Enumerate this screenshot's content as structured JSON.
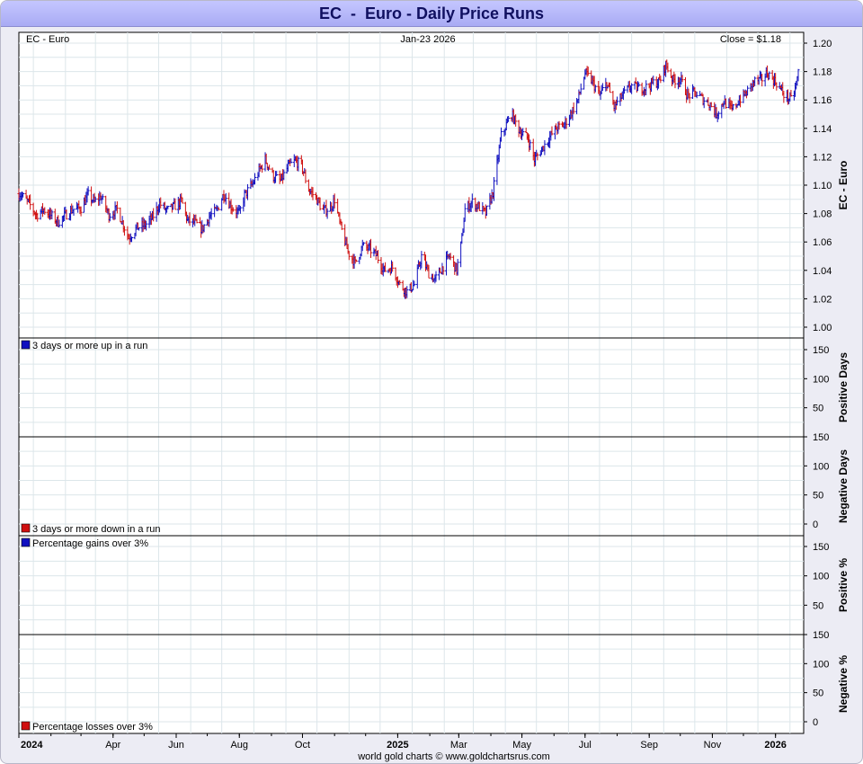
{
  "page": {
    "title": "EC  -  Euro - Daily Price Runs",
    "footer": "world gold charts © www.goldchartsrus.com"
  },
  "colors": {
    "up": "#1010c0",
    "down": "#d01010",
    "grid": "#dce6ea",
    "frame": "#ececf4",
    "title_bar": "#b4b6fa"
  },
  "chart_data": [
    {
      "type": "ohlc",
      "header_left": "EC  -  Euro",
      "header_center": "Jan-23  2026",
      "header_right": "Close = $1.18",
      "ylabel": "EC  -  Euro",
      "ylim": [
        1.0,
        1.2
      ],
      "yticks": [
        "1.20",
        "1.18",
        "1.16",
        "1.14",
        "1.12",
        "1.10",
        "1.08",
        "1.06",
        "1.04",
        "1.02",
        "1.00"
      ],
      "grid": true,
      "x_start": "2024-01-01",
      "x_end": "2026-01-23",
      "close_series": [
        [
          "2024-01-02",
          1.094
        ],
        [
          "2024-01-10",
          1.088
        ],
        [
          "2024-01-18",
          1.079
        ],
        [
          "2024-01-25",
          1.083
        ],
        [
          "2024-02-02",
          1.078
        ],
        [
          "2024-02-08",
          1.074
        ],
        [
          "2024-02-15",
          1.079
        ],
        [
          "2024-02-22",
          1.083
        ],
        [
          "2024-03-01",
          1.084
        ],
        [
          "2024-03-08",
          1.093
        ],
        [
          "2024-03-14",
          1.088
        ],
        [
          "2024-03-20",
          1.092
        ],
        [
          "2024-03-28",
          1.079
        ],
        [
          "2024-04-05",
          1.083
        ],
        [
          "2024-04-11",
          1.072
        ],
        [
          "2024-04-16",
          1.063
        ],
        [
          "2024-04-24",
          1.07
        ],
        [
          "2024-05-02",
          1.072
        ],
        [
          "2024-05-09",
          1.077
        ],
        [
          "2024-05-16",
          1.087
        ],
        [
          "2024-05-23",
          1.082
        ],
        [
          "2024-05-30",
          1.085
        ],
        [
          "2024-06-06",
          1.089
        ],
        [
          "2024-06-12",
          1.075
        ],
        [
          "2024-06-18",
          1.074
        ],
        [
          "2024-06-26",
          1.069
        ],
        [
          "2024-07-03",
          1.078
        ],
        [
          "2024-07-10",
          1.082
        ],
        [
          "2024-07-17",
          1.094
        ],
        [
          "2024-07-24",
          1.085
        ],
        [
          "2024-08-01",
          1.08
        ],
        [
          "2024-08-06",
          1.093
        ],
        [
          "2024-08-14",
          1.101
        ],
        [
          "2024-08-20",
          1.11
        ],
        [
          "2024-08-26",
          1.118
        ],
        [
          "2024-09-03",
          1.106
        ],
        [
          "2024-09-10",
          1.103
        ],
        [
          "2024-09-17",
          1.113
        ],
        [
          "2024-09-24",
          1.117
        ],
        [
          "2024-09-30",
          1.114
        ],
        [
          "2024-10-07",
          1.097
        ],
        [
          "2024-10-14",
          1.091
        ],
        [
          "2024-10-21",
          1.082
        ],
        [
          "2024-10-28",
          1.084
        ],
        [
          "2024-11-01",
          1.09
        ],
        [
          "2024-11-06",
          1.073
        ],
        [
          "2024-11-14",
          1.053
        ],
        [
          "2024-11-21",
          1.045
        ],
        [
          "2024-11-28",
          1.057
        ],
        [
          "2024-12-05",
          1.055
        ],
        [
          "2024-12-12",
          1.05
        ],
        [
          "2024-12-19",
          1.04
        ],
        [
          "2024-12-27",
          1.042
        ],
        [
          "2025-01-03",
          1.03
        ],
        [
          "2025-01-10",
          1.025
        ],
        [
          "2025-01-17",
          1.03
        ],
        [
          "2025-01-24",
          1.05
        ],
        [
          "2025-01-31",
          1.038
        ],
        [
          "2025-02-06",
          1.033
        ],
        [
          "2025-02-13",
          1.042
        ],
        [
          "2025-02-20",
          1.05
        ],
        [
          "2025-02-27",
          1.04
        ],
        [
          "2025-03-04",
          1.062
        ],
        [
          "2025-03-07",
          1.083
        ],
        [
          "2025-03-14",
          1.088
        ],
        [
          "2025-03-20",
          1.085
        ],
        [
          "2025-03-27",
          1.08
        ],
        [
          "2025-04-03",
          1.095
        ],
        [
          "2025-04-11",
          1.135
        ],
        [
          "2025-04-21",
          1.15
        ],
        [
          "2025-04-29",
          1.138
        ],
        [
          "2025-05-07",
          1.133
        ],
        [
          "2025-05-13",
          1.118
        ],
        [
          "2025-05-20",
          1.125
        ],
        [
          "2025-05-27",
          1.133
        ],
        [
          "2025-06-03",
          1.14
        ],
        [
          "2025-06-10",
          1.142
        ],
        [
          "2025-06-17",
          1.15
        ],
        [
          "2025-06-24",
          1.16
        ],
        [
          "2025-07-01",
          1.179
        ],
        [
          "2025-07-08",
          1.173
        ],
        [
          "2025-07-15",
          1.163
        ],
        [
          "2025-07-22",
          1.172
        ],
        [
          "2025-07-29",
          1.155
        ],
        [
          "2025-08-01",
          1.158
        ],
        [
          "2025-08-08",
          1.165
        ],
        [
          "2025-08-15",
          1.17
        ],
        [
          "2025-08-22",
          1.168
        ],
        [
          "2025-08-29",
          1.169
        ],
        [
          "2025-09-05",
          1.172
        ],
        [
          "2025-09-11",
          1.173
        ],
        [
          "2025-09-17",
          1.185
        ],
        [
          "2025-09-24",
          1.174
        ],
        [
          "2025-10-01",
          1.175
        ],
        [
          "2025-10-08",
          1.163
        ],
        [
          "2025-10-15",
          1.165
        ],
        [
          "2025-10-22",
          1.161
        ],
        [
          "2025-10-30",
          1.157
        ],
        [
          "2025-11-05",
          1.15
        ],
        [
          "2025-11-12",
          1.159
        ],
        [
          "2025-11-20",
          1.153
        ],
        [
          "2025-11-27",
          1.16
        ],
        [
          "2025-12-04",
          1.165
        ],
        [
          "2025-12-11",
          1.173
        ],
        [
          "2025-12-18",
          1.174
        ],
        [
          "2025-12-24",
          1.179
        ],
        [
          "2026-01-02",
          1.172
        ],
        [
          "2026-01-09",
          1.164
        ],
        [
          "2026-01-16",
          1.16
        ],
        [
          "2026-01-21",
          1.17
        ],
        [
          "2026-01-23",
          1.18
        ]
      ]
    },
    {
      "type": "bar",
      "ylabel": "Positive Days",
      "legend": "3 days or more up in a run",
      "ylim": [
        0,
        150
      ],
      "yticks": [
        "150",
        "100",
        "50"
      ],
      "values": []
    },
    {
      "type": "bar",
      "ylabel": "Negative Days",
      "legend": "3 days or more down in a run",
      "ylim": [
        0,
        150
      ],
      "yticks": [
        "150",
        "100",
        "50",
        "0"
      ],
      "values": []
    },
    {
      "type": "bar",
      "ylabel": "Positive %",
      "legend": "Percentage gains over 3%",
      "ylim": [
        0,
        150
      ],
      "yticks": [
        "150",
        "100",
        "50"
      ],
      "values": []
    },
    {
      "type": "bar",
      "ylabel": "Negative %",
      "legend": "Percentage losses over 3%",
      "ylim": [
        0,
        150
      ],
      "yticks": [
        "150",
        "100",
        "50",
        "0"
      ],
      "values": []
    }
  ],
  "x_axis": {
    "ticks": [
      {
        "date": "2024-01-01",
        "label": "2024",
        "bold": true
      },
      {
        "date": "2024-04-01",
        "label": "Apr",
        "bold": false
      },
      {
        "date": "2024-06-01",
        "label": "Jun",
        "bold": false
      },
      {
        "date": "2024-08-01",
        "label": "Aug",
        "bold": false
      },
      {
        "date": "2024-10-01",
        "label": "Oct",
        "bold": false
      },
      {
        "date": "2025-01-01",
        "label": "2025",
        "bold": true
      },
      {
        "date": "2025-03-01",
        "label": "Mar",
        "bold": false
      },
      {
        "date": "2025-05-01",
        "label": "May",
        "bold": false
      },
      {
        "date": "2025-07-01",
        "label": "Jul",
        "bold": false
      },
      {
        "date": "2025-09-01",
        "label": "Sep",
        "bold": false
      },
      {
        "date": "2025-11-01",
        "label": "Nov",
        "bold": false
      },
      {
        "date": "2026-01-01",
        "label": "2026",
        "bold": true
      }
    ]
  }
}
